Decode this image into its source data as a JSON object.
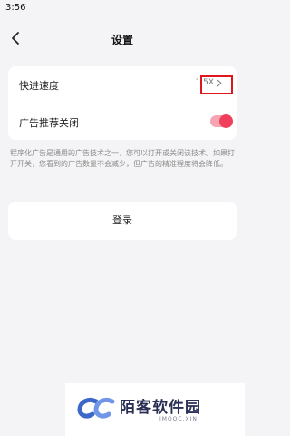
{
  "status_bar": {
    "time": "3:56"
  },
  "header": {
    "title": "设置",
    "back_icon": "chevron-left-icon"
  },
  "settings": {
    "playback_speed": {
      "label": "快进速度",
      "value": "1.5X",
      "chevron_icon": "chevron-right-icon",
      "highlight_color": "#e0161c"
    },
    "ad_recommendation": {
      "label": "广告推荐关闭",
      "enabled": true,
      "toggle_color": "#ef3f5b"
    }
  },
  "note": "程序化广告是通用的广告技术之一，您可以打开或关闭该技术。如果打开开关，您看到的广告数量不会减少，但广告的精准程度将会降低。",
  "login": {
    "label": "登录"
  },
  "watermark": {
    "name": "陌客软件园",
    "domain": "IMOOC.XIN",
    "logo_icon": "double-c-logo-icon"
  }
}
